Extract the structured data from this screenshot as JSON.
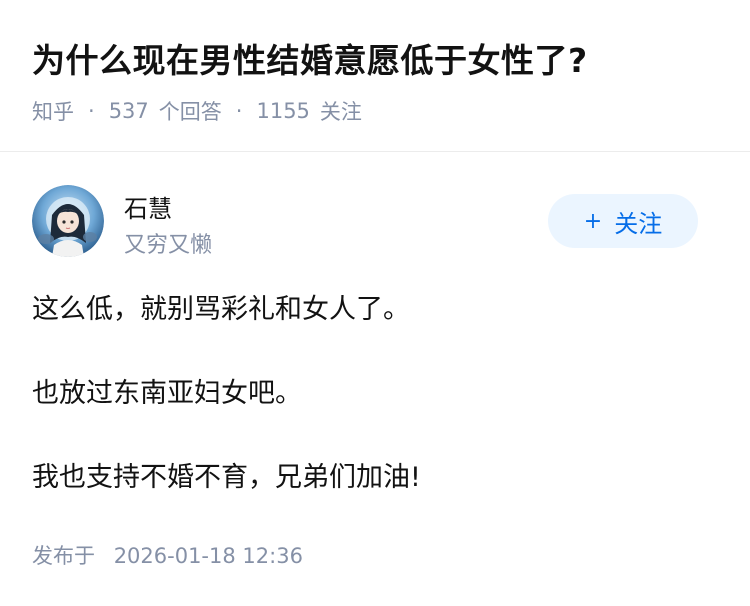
{
  "question": {
    "title": "为什么现在男性结婚意愿低于女性了?",
    "source": "知乎",
    "answer_count": "537",
    "answer_label": "个回答",
    "follow_count": "1155",
    "follow_label": "关注"
  },
  "author": {
    "name": "石慧",
    "bio": "又穷又懒",
    "follow_button": "关注",
    "avatar_icon": "anime-girl-avatar"
  },
  "answer": {
    "paragraphs": [
      "这么低，就别骂彩礼和女人了。",
      "也放过东南亚妇女吧。",
      "我也支持不婚不育，兄弟们加油!"
    ],
    "published_label": "发布于",
    "published_time": "2026-01-18 12:36"
  },
  "colors": {
    "meta_gray": "#8590a6",
    "accent_blue": "#056de8",
    "follow_bg": "#ebf5ff"
  }
}
